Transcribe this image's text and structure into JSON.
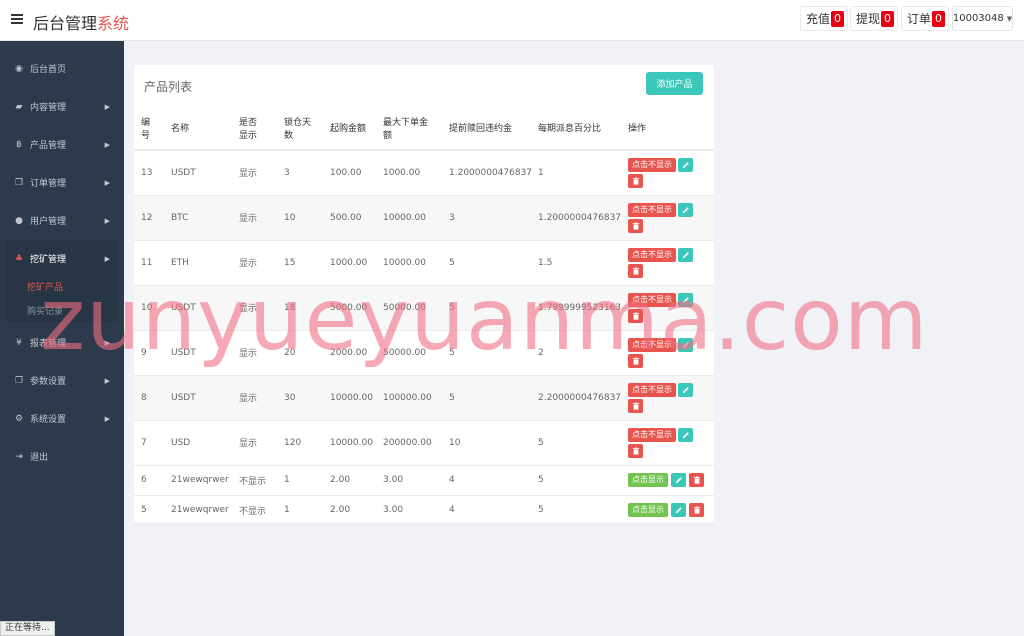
{
  "header": {
    "brand_main": "后台管理",
    "brand_accent": "系统",
    "recharge_label": "充值",
    "recharge_count": "0",
    "withdraw_label": "提现",
    "withdraw_count": "0",
    "order_label": "订单",
    "order_count": "0",
    "user": "10003048"
  },
  "sidebar": {
    "items": [
      {
        "label": "后台首页",
        "icon": "dashboard-icon"
      },
      {
        "label": "内容管理",
        "icon": "book-icon"
      },
      {
        "label": "产品管理",
        "icon": "bitcoin-icon"
      },
      {
        "label": "订单管理",
        "icon": "copy-icon"
      },
      {
        "label": "用户管理",
        "icon": "user-icon"
      },
      {
        "label": "挖矿管理",
        "icon": "sitemap-icon"
      },
      {
        "label": "报表管理",
        "icon": "yen-icon"
      },
      {
        "label": "参数设置",
        "icon": "copy-icon"
      },
      {
        "label": "系统设置",
        "icon": "cogs-icon"
      },
      {
        "label": "退出",
        "icon": "sign-out-icon"
      }
    ],
    "sub_items": [
      {
        "label": "挖矿产品"
      },
      {
        "label": "购买记录"
      }
    ]
  },
  "panel": {
    "title": "产品列表",
    "add_button": "添加产品"
  },
  "table": {
    "headers": [
      "编号",
      "名称",
      "是否显示",
      "锁仓天数",
      "起购金额",
      "最大下单金额",
      "提前赎回违约金",
      "每期派息百分比",
      "操作"
    ],
    "rows": [
      {
        "id": "13",
        "name": "USDT",
        "show": "显示",
        "days": "3",
        "min": "100.00",
        "max": "1000.00",
        "penalty": "1.2000000476837",
        "rate": "1",
        "toggle": "点击不显示"
      },
      {
        "id": "12",
        "name": "BTC",
        "show": "显示",
        "days": "10",
        "min": "500.00",
        "max": "10000.00",
        "penalty": "3",
        "rate": "1.2000000476837",
        "toggle": "点击不显示"
      },
      {
        "id": "11",
        "name": "ETH",
        "show": "显示",
        "days": "15",
        "min": "1000.00",
        "max": "10000.00",
        "penalty": "5",
        "rate": "1.5",
        "toggle": "点击不显示"
      },
      {
        "id": "10",
        "name": "USDT",
        "show": "显示",
        "days": "18",
        "min": "5000.00",
        "max": "50000.00",
        "penalty": "5",
        "rate": "1.7999999523163",
        "toggle": "点击不显示"
      },
      {
        "id": "9",
        "name": "USDT",
        "show": "显示",
        "days": "20",
        "min": "2000.00",
        "max": "50000.00",
        "penalty": "5",
        "rate": "2",
        "toggle": "点击不显示"
      },
      {
        "id": "8",
        "name": "USDT",
        "show": "显示",
        "days": "30",
        "min": "10000.00",
        "max": "100000.00",
        "penalty": "5",
        "rate": "2.2000000476837",
        "toggle": "点击不显示"
      },
      {
        "id": "7",
        "name": "USD",
        "show": "显示",
        "days": "120",
        "min": "10000.00",
        "max": "200000.00",
        "penalty": "10",
        "rate": "5",
        "toggle": "点击不显示"
      },
      {
        "id": "6",
        "name": "21wewqrwer",
        "show": "不显示",
        "days": "1",
        "min": "2.00",
        "max": "3.00",
        "penalty": "4",
        "rate": "5",
        "toggle": "点击显示"
      },
      {
        "id": "5",
        "name": "21wewqrwer",
        "show": "不显示",
        "days": "1",
        "min": "2.00",
        "max": "3.00",
        "penalty": "4",
        "rate": "5",
        "toggle": "点击显示"
      }
    ]
  },
  "watermark": "zunyueyuanma.com",
  "status_bar": "正在等待...",
  "colors": {
    "sidebar_bg": "#2d3a4b",
    "accent_red": "#e8554e",
    "teal": "#3cc8b8",
    "green": "#72c44f",
    "badge_red": "#e60012"
  }
}
